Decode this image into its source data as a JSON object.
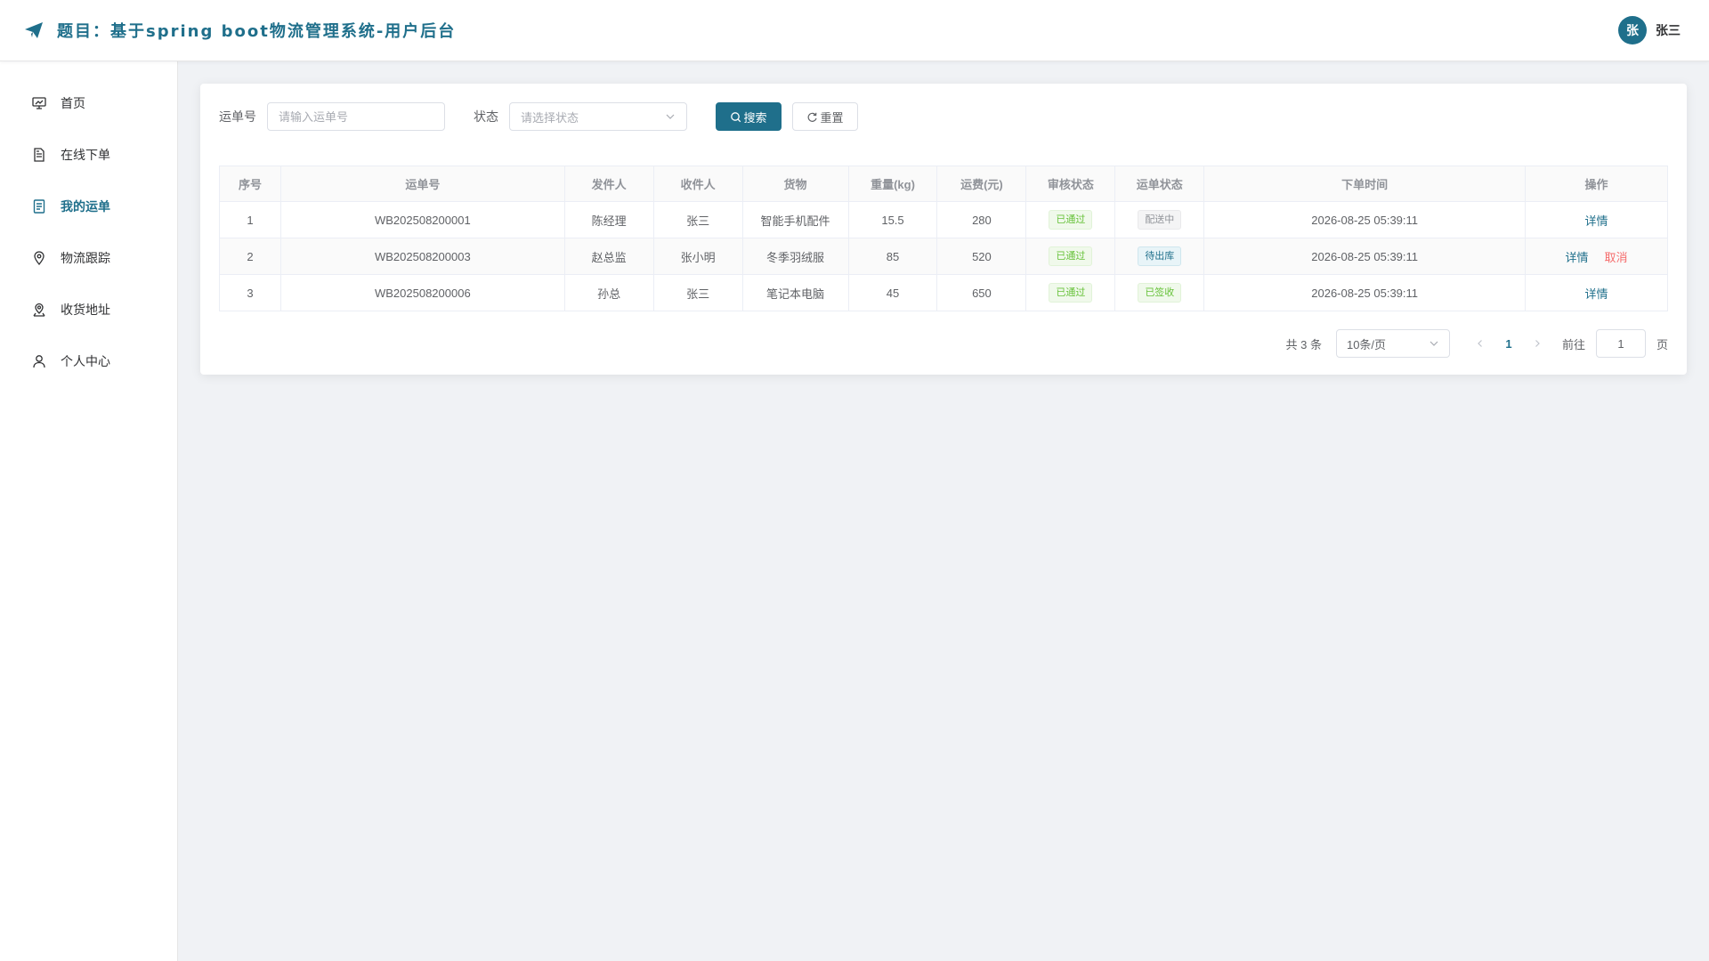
{
  "header": {
    "title": "题目：基于spring boot物流管理系统-用户后台",
    "avatar_text": "张",
    "user_name": "张三"
  },
  "sidebar": {
    "items": [
      {
        "label": "首页",
        "icon": "monitor-icon"
      },
      {
        "label": "在线下单",
        "icon": "document-icon"
      },
      {
        "label": "我的运单",
        "icon": "list-document-icon",
        "active": true
      },
      {
        "label": "物流跟踪",
        "icon": "location-pin-icon"
      },
      {
        "label": "收货地址",
        "icon": "address-pin-icon"
      },
      {
        "label": "个人中心",
        "icon": "user-icon"
      }
    ]
  },
  "search": {
    "waybill_label": "运单号",
    "waybill_placeholder": "请输入运单号",
    "status_label": "状态",
    "status_placeholder": "请选择状态",
    "search_button": "搜索",
    "reset_button": "重置"
  },
  "table": {
    "headers": [
      "序号",
      "运单号",
      "发件人",
      "收件人",
      "货物",
      "重量(kg)",
      "运费(元)",
      "审核状态",
      "运单状态",
      "下单时间",
      "操作"
    ],
    "rows": [
      {
        "index": "1",
        "waybill": "WB202508200001",
        "sender": "陈经理",
        "receiver": "张三",
        "goods": "智能手机配件",
        "weight": "15.5",
        "fee": "280",
        "audit": "已通过",
        "status": "配送中",
        "time": "2026-08-25 05:39:11",
        "action_detail": "详情",
        "action_cancel": ""
      },
      {
        "index": "2",
        "waybill": "WB202508200003",
        "sender": "赵总监",
        "receiver": "张小明",
        "goods": "冬季羽绒服",
        "weight": "85",
        "fee": "520",
        "audit": "已通过",
        "status": "待出库",
        "time": "2026-08-25 05:39:11",
        "action_detail": "详情",
        "action_cancel": "取消"
      },
      {
        "index": "3",
        "waybill": "WB202508200006",
        "sender": "孙总",
        "receiver": "张三",
        "goods": "笔记本电脑",
        "weight": "45",
        "fee": "650",
        "audit": "已通过",
        "status": "已签收",
        "time": "2026-08-25 05:39:11",
        "action_detail": "详情",
        "action_cancel": ""
      }
    ]
  },
  "pagination": {
    "total_text": "共 3 条",
    "page_size": "10条/页",
    "current_page": "1",
    "goto_label": "前往",
    "goto_value": "1",
    "page_suffix": "页"
  },
  "colors": {
    "primary": "#1f6f8b",
    "success": "#67c23a",
    "danger": "#f56c6c"
  }
}
